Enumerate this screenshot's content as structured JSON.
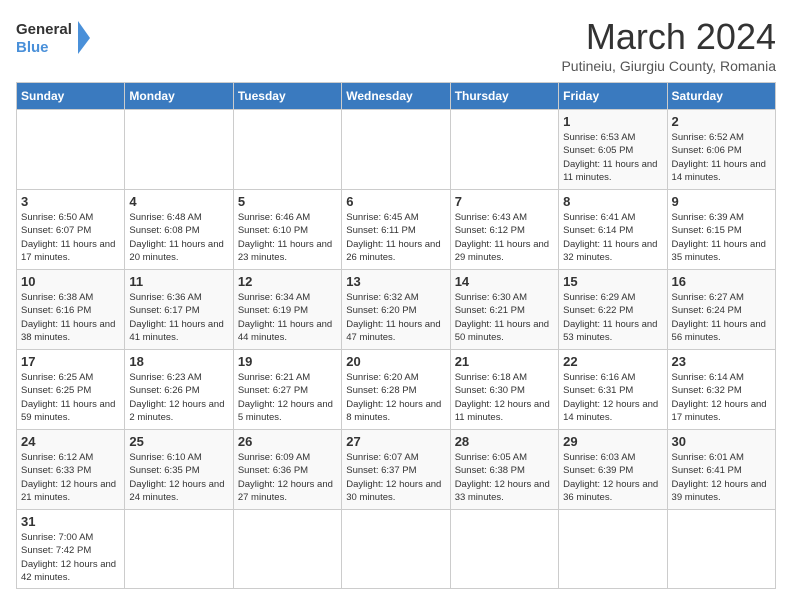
{
  "logo": {
    "text_general": "General",
    "text_blue": "Blue"
  },
  "title": "March 2024",
  "subtitle": "Putineiu, Giurgiu County, Romania",
  "days_of_week": [
    "Sunday",
    "Monday",
    "Tuesday",
    "Wednesday",
    "Thursday",
    "Friday",
    "Saturday"
  ],
  "weeks": [
    [
      {
        "day": "",
        "info": ""
      },
      {
        "day": "",
        "info": ""
      },
      {
        "day": "",
        "info": ""
      },
      {
        "day": "",
        "info": ""
      },
      {
        "day": "",
        "info": ""
      },
      {
        "day": "1",
        "info": "Sunrise: 6:53 AM\nSunset: 6:05 PM\nDaylight: 11 hours\nand 11 minutes."
      },
      {
        "day": "2",
        "info": "Sunrise: 6:52 AM\nSunset: 6:06 PM\nDaylight: 11 hours\nand 14 minutes."
      }
    ],
    [
      {
        "day": "3",
        "info": "Sunrise: 6:50 AM\nSunset: 6:07 PM\nDaylight: 11 hours\nand 17 minutes."
      },
      {
        "day": "4",
        "info": "Sunrise: 6:48 AM\nSunset: 6:08 PM\nDaylight: 11 hours\nand 20 minutes."
      },
      {
        "day": "5",
        "info": "Sunrise: 6:46 AM\nSunset: 6:10 PM\nDaylight: 11 hours\nand 23 minutes."
      },
      {
        "day": "6",
        "info": "Sunrise: 6:45 AM\nSunset: 6:11 PM\nDaylight: 11 hours\nand 26 minutes."
      },
      {
        "day": "7",
        "info": "Sunrise: 6:43 AM\nSunset: 6:12 PM\nDaylight: 11 hours\nand 29 minutes."
      },
      {
        "day": "8",
        "info": "Sunrise: 6:41 AM\nSunset: 6:14 PM\nDaylight: 11 hours\nand 32 minutes."
      },
      {
        "day": "9",
        "info": "Sunrise: 6:39 AM\nSunset: 6:15 PM\nDaylight: 11 hours\nand 35 minutes."
      }
    ],
    [
      {
        "day": "10",
        "info": "Sunrise: 6:38 AM\nSunset: 6:16 PM\nDaylight: 11 hours\nand 38 minutes."
      },
      {
        "day": "11",
        "info": "Sunrise: 6:36 AM\nSunset: 6:17 PM\nDaylight: 11 hours\nand 41 minutes."
      },
      {
        "day": "12",
        "info": "Sunrise: 6:34 AM\nSunset: 6:19 PM\nDaylight: 11 hours\nand 44 minutes."
      },
      {
        "day": "13",
        "info": "Sunrise: 6:32 AM\nSunset: 6:20 PM\nDaylight: 11 hours\nand 47 minutes."
      },
      {
        "day": "14",
        "info": "Sunrise: 6:30 AM\nSunset: 6:21 PM\nDaylight: 11 hours\nand 50 minutes."
      },
      {
        "day": "15",
        "info": "Sunrise: 6:29 AM\nSunset: 6:22 PM\nDaylight: 11 hours\nand 53 minutes."
      },
      {
        "day": "16",
        "info": "Sunrise: 6:27 AM\nSunset: 6:24 PM\nDaylight: 11 hours\nand 56 minutes."
      }
    ],
    [
      {
        "day": "17",
        "info": "Sunrise: 6:25 AM\nSunset: 6:25 PM\nDaylight: 11 hours\nand 59 minutes."
      },
      {
        "day": "18",
        "info": "Sunrise: 6:23 AM\nSunset: 6:26 PM\nDaylight: 12 hours\nand 2 minutes."
      },
      {
        "day": "19",
        "info": "Sunrise: 6:21 AM\nSunset: 6:27 PM\nDaylight: 12 hours\nand 5 minutes."
      },
      {
        "day": "20",
        "info": "Sunrise: 6:20 AM\nSunset: 6:28 PM\nDaylight: 12 hours\nand 8 minutes."
      },
      {
        "day": "21",
        "info": "Sunrise: 6:18 AM\nSunset: 6:30 PM\nDaylight: 12 hours\nand 11 minutes."
      },
      {
        "day": "22",
        "info": "Sunrise: 6:16 AM\nSunset: 6:31 PM\nDaylight: 12 hours\nand 14 minutes."
      },
      {
        "day": "23",
        "info": "Sunrise: 6:14 AM\nSunset: 6:32 PM\nDaylight: 12 hours\nand 17 minutes."
      }
    ],
    [
      {
        "day": "24",
        "info": "Sunrise: 6:12 AM\nSunset: 6:33 PM\nDaylight: 12 hours\nand 21 minutes."
      },
      {
        "day": "25",
        "info": "Sunrise: 6:10 AM\nSunset: 6:35 PM\nDaylight: 12 hours\nand 24 minutes."
      },
      {
        "day": "26",
        "info": "Sunrise: 6:09 AM\nSunset: 6:36 PM\nDaylight: 12 hours\nand 27 minutes."
      },
      {
        "day": "27",
        "info": "Sunrise: 6:07 AM\nSunset: 6:37 PM\nDaylight: 12 hours\nand 30 minutes."
      },
      {
        "day": "28",
        "info": "Sunrise: 6:05 AM\nSunset: 6:38 PM\nDaylight: 12 hours\nand 33 minutes."
      },
      {
        "day": "29",
        "info": "Sunrise: 6:03 AM\nSunset: 6:39 PM\nDaylight: 12 hours\nand 36 minutes."
      },
      {
        "day": "30",
        "info": "Sunrise: 6:01 AM\nSunset: 6:41 PM\nDaylight: 12 hours\nand 39 minutes."
      }
    ],
    [
      {
        "day": "31",
        "info": "Sunrise: 7:00 AM\nSunset: 7:42 PM\nDaylight: 12 hours\nand 42 minutes."
      },
      {
        "day": "",
        "info": ""
      },
      {
        "day": "",
        "info": ""
      },
      {
        "day": "",
        "info": ""
      },
      {
        "day": "",
        "info": ""
      },
      {
        "day": "",
        "info": ""
      },
      {
        "day": "",
        "info": ""
      }
    ]
  ]
}
